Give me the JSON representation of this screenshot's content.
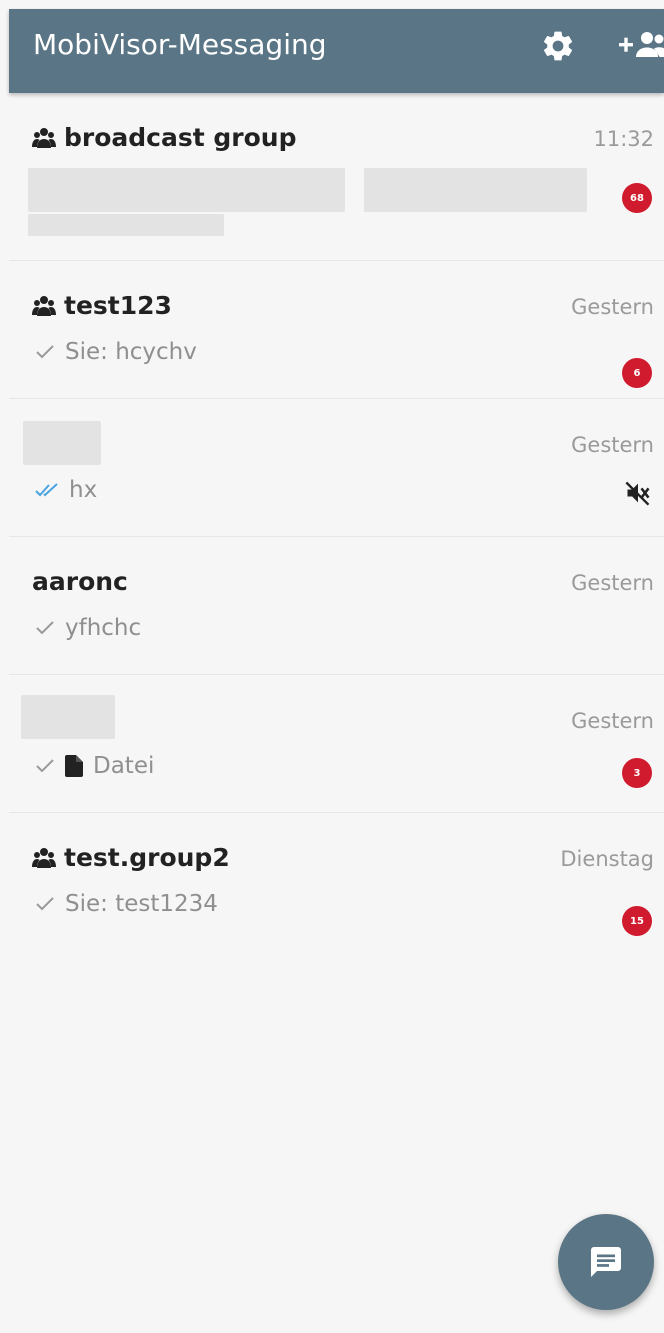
{
  "header": {
    "title": "MobiVisor-Messaging",
    "icons": [
      "gear-icon",
      "add-user-icon"
    ]
  },
  "conversations": [
    {
      "name": "broadcast group",
      "is_group": true,
      "time": "11:32",
      "preview": "",
      "unread": "68",
      "blurred_preview": true
    },
    {
      "name": "test123",
      "is_group": true,
      "time": "Gestern",
      "preview": "Sie: hcychv",
      "check": "single",
      "unread": "6"
    },
    {
      "name": "",
      "is_group": false,
      "time": "Gestern",
      "preview": "hx",
      "check": "double-blue",
      "muted": true,
      "blurred_name": true
    },
    {
      "name": "aaronc",
      "is_group": false,
      "time": "Gestern",
      "preview": "yfhchc",
      "check": "single"
    },
    {
      "name": "",
      "is_group": false,
      "time": "Gestern",
      "preview": "Datei",
      "check": "single",
      "file_icon": true,
      "unread": "3",
      "blurred_name": true
    },
    {
      "name": "test.group2",
      "is_group": true,
      "time": "Dienstag",
      "preview": "Sie: test1234",
      "check": "single",
      "unread": "15"
    }
  ],
  "colors": {
    "appbar": "#5a7585",
    "badge": "#d01a2e",
    "double_check": "#4aa3df"
  },
  "fab": {
    "icon": "message-icon"
  }
}
